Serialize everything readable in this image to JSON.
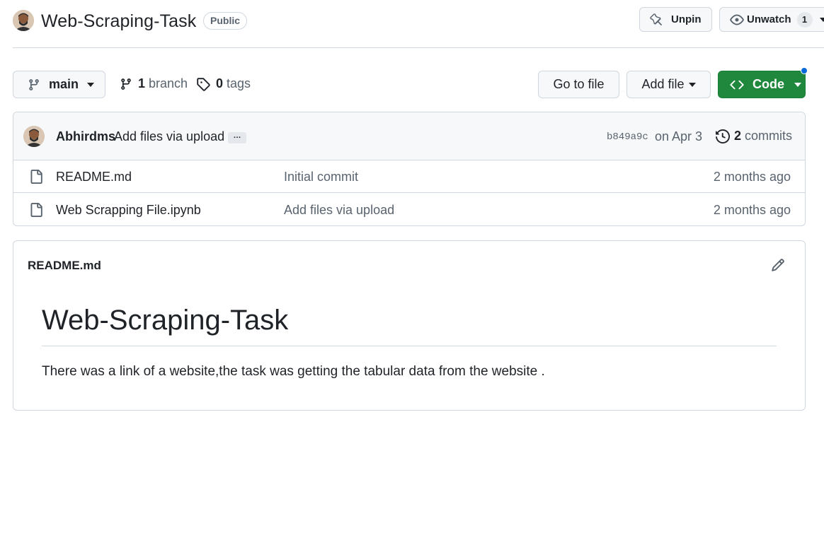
{
  "repo": {
    "name": "Web-Scraping-Task",
    "visibility": "Public",
    "unpin_label": "Unpin",
    "unwatch_label": "Unwatch",
    "watch_count": "1"
  },
  "toolbar": {
    "branch_label": "main",
    "branches_count": "1",
    "branches_label": "branch",
    "tags_count": "0",
    "tags_label": "tags",
    "goto_file_label": "Go to file",
    "add_file_label": "Add file",
    "code_label": "Code"
  },
  "latest_commit": {
    "author": "Abhirdms",
    "message": "Add files via upload",
    "ellipsis": "…",
    "sha": "b849a9c",
    "date": "on Apr 3",
    "commits_count": "2",
    "commits_label": "commits"
  },
  "files": [
    {
      "name": "README.md",
      "commit": "Initial commit",
      "age": "2 months ago"
    },
    {
      "name": "Web Scrapping File.ipynb",
      "commit": "Add files via upload",
      "age": "2 months ago"
    }
  ],
  "readme": {
    "file_name": "README.md",
    "title": "Web-Scraping-Task",
    "body": "There was a link of a website,the task was getting the tabular data from the website ."
  },
  "colors": {
    "primary_button": "#1f883d",
    "border": "#d0d7de",
    "muted_text": "#59636e",
    "notification_dot": "#0969da"
  },
  "icons": [
    "avatar",
    "pin-icon",
    "eye-icon",
    "branch-icon",
    "tag-icon",
    "code-icon",
    "history-icon",
    "file-icon",
    "pencil-icon"
  ]
}
